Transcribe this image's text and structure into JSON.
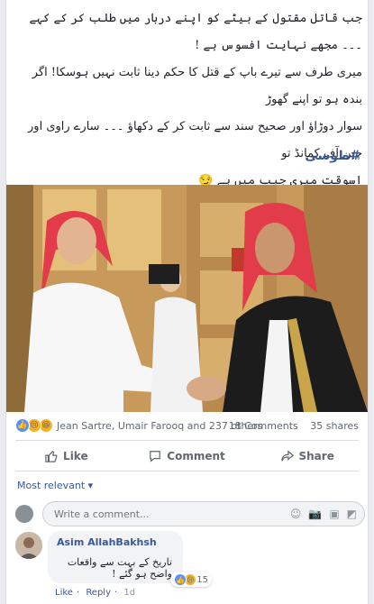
{
  "post": {
    "lines": [
      "جب قاتل مقتول کے بیٹے کو اپنے دربار میں طلب کر کے کہے ۔۔۔ مجھے نہایت افسوس ہے !",
      "میری طرف سے تیرے باپ کے قتل کا حکم دینا ثابت نہیں ہوسکا! اگر بندہ ہو تو اپنے گھوڑ",
      "سوار دوڑاؤ اور صحیح سند سے ثابت کر کے دکھاؤ ۔۔۔ سارے راوی اور چین آف کمانڈ تو",
      "اسوقت میری جیب میں ہے 😏"
    ],
    "hashtag": "#طوسی"
  },
  "reactions": {
    "names": "Jean Sartre, Umair Farooq and 237 others",
    "comments": "18 Comments",
    "shares": "35 shares"
  },
  "actions": {
    "like": "Like",
    "comment": "Comment",
    "share": "Share"
  },
  "sort_label": "Most relevant ▾",
  "comment_input": {
    "placeholder": "Write a comment..."
  },
  "comment": {
    "author": "Asim AllahBakhsh",
    "text": "تاریخ کے بہت سے واقعات واضح ہو گئے !",
    "reaction_count": "15",
    "like": "Like",
    "reply": "Reply",
    "time": "1d"
  },
  "colors": {
    "link": "#385898",
    "like_blue": "#5890ff",
    "emoji_yellow": "#f7b125"
  }
}
